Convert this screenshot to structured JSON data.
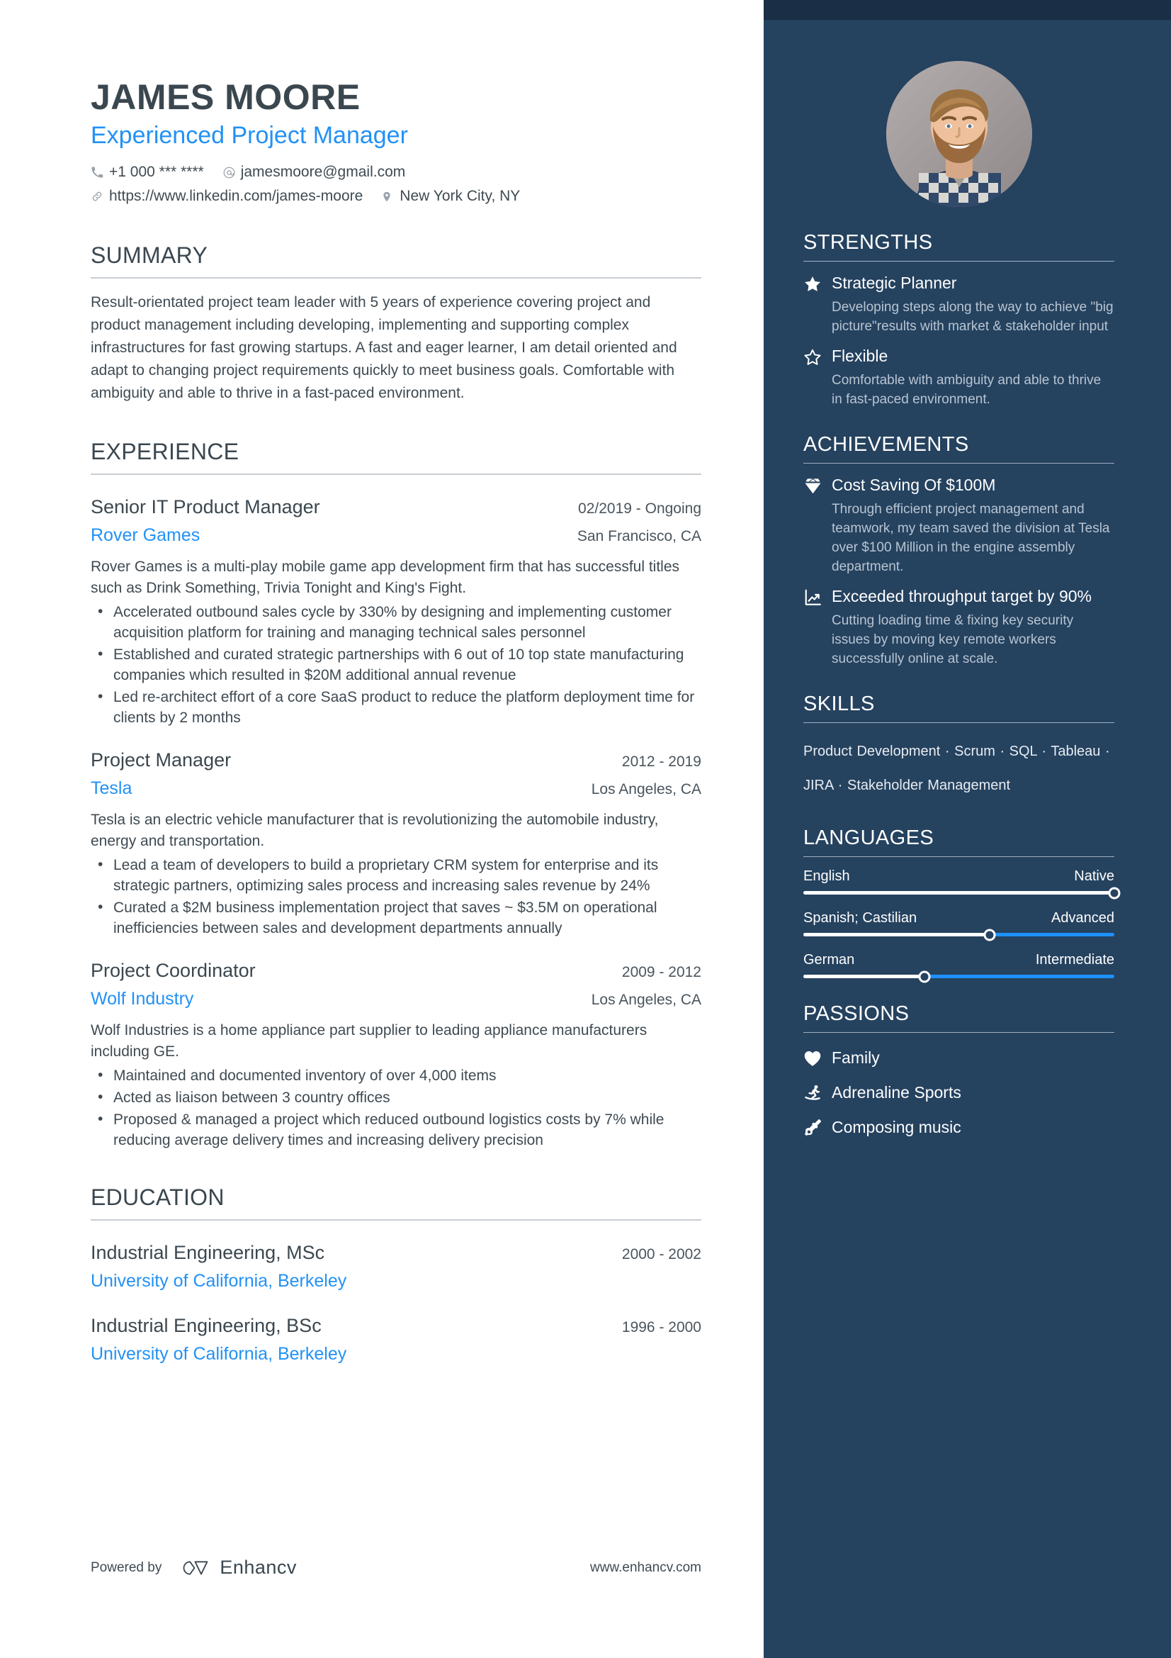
{
  "header": {
    "name": "JAMES MOORE",
    "headline": "Experienced Project Manager",
    "contacts": [
      {
        "icon": "phone-icon",
        "text": "+1 000 *** ****"
      },
      {
        "icon": "email-icon",
        "text": "jamesmoore@gmail.com"
      },
      {
        "icon": "link-icon",
        "text": "https://www.linkedin.com/james-moore"
      },
      {
        "icon": "location-icon",
        "text": "New York City, NY"
      }
    ]
  },
  "summary": {
    "title": "SUMMARY",
    "text": "Result-orientated project team leader with 5 years of experience covering project and product management including developing, implementing and supporting complex infrastructures for fast growing startups. A fast and eager learner, I am detail oriented and adapt to changing project requirements quickly to meet business goals. Comfortable with ambiguity and able to thrive in a fast-paced environment."
  },
  "experience": {
    "title": "EXPERIENCE",
    "jobs": [
      {
        "title": "Senior IT Product Manager",
        "date": "02/2019 - Ongoing",
        "org": "Rover Games",
        "location": "San Francisco, CA",
        "desc": "Rover Games is a multi-play mobile game app development firm that has successful titles such as Drink Something, Trivia Tonight and King's Fight.",
        "bullets": [
          "Accelerated outbound sales cycle by 330% by designing and implementing customer acquisition platform for training and managing technical sales personnel",
          "Established and curated strategic partnerships with 6 out of 10 top state manufacturing companies which resulted in $20M additional annual revenue",
          "Led re-architect effort of a core SaaS product to reduce the platform deployment time for clients by 2 months"
        ]
      },
      {
        "title": "Project Manager",
        "date": "2012 - 2019",
        "org": "Tesla",
        "location": "Los Angeles, CA",
        "desc": "Tesla is an electric vehicle manufacturer that is revolutionizing the automobile industry, energy and transportation.",
        "bullets": [
          "Lead a team of developers to build a proprietary CRM system for enterprise and its strategic partners, optimizing sales process and increasing sales revenue by 24%",
          "Curated a $2M business implementation project that saves ~ $3.5M on operational inefficiencies between sales and development departments annually"
        ]
      },
      {
        "title": "Project Coordinator",
        "date": "2009 - 2012",
        "org": "Wolf Industry",
        "location": "Los Angeles, CA",
        "desc": "Wolf Industries is a home appliance part supplier to leading appliance manufacturers including GE.",
        "bullets": [
          "Maintained and documented inventory of over 4,000 items",
          "Acted as liaison between 3 country offices",
          "Proposed & managed a project which reduced outbound logistics costs by 7% while reducing average delivery times and increasing delivery precision"
        ]
      }
    ]
  },
  "education": {
    "title": "EDUCATION",
    "items": [
      {
        "degree": "Industrial Engineering, MSc",
        "date": "2000 - 2002",
        "school": "University of California, Berkeley"
      },
      {
        "degree": "Industrial Engineering, BSc",
        "date": "1996 - 2000",
        "school": "University of California, Berkeley"
      }
    ]
  },
  "strengths": {
    "title": "STRENGTHS",
    "items": [
      {
        "icon": "star-filled-icon",
        "name": "Strategic Planner",
        "desc": "Developing steps along the way to achieve \"big picture\"results with market & stakeholder input"
      },
      {
        "icon": "star-outline-icon",
        "name": "Flexible",
        "desc": "Comfortable with ambiguity and able to thrive in fast-paced environment."
      }
    ]
  },
  "achievements": {
    "title": "ACHIEVEMENTS",
    "items": [
      {
        "icon": "diamond-icon",
        "name": "Cost Saving Of $100M",
        "desc": "Through efficient project management and teamwork, my team saved the division at Tesla over $100 Million in the engine assembly department."
      },
      {
        "icon": "chart-up-icon",
        "name": "Exceeded throughput target by 90%",
        "desc": "Cutting loading time & fixing key security issues by moving key remote workers successfully online at scale."
      }
    ]
  },
  "skills": {
    "title": "SKILLS",
    "text": "Product Development · Scrum · SQL · Tableau · JIRA · Stakeholder Management"
  },
  "languages": {
    "title": "LANGUAGES",
    "items": [
      {
        "name": "English",
        "level": "Native",
        "percent": 100
      },
      {
        "name": "Spanish; Castilian",
        "level": "Advanced",
        "percent": 60
      },
      {
        "name": "German",
        "level": "Intermediate",
        "percent": 39
      }
    ]
  },
  "passions": {
    "title": "PASSIONS",
    "items": [
      {
        "icon": "heart-icon",
        "label": "Family"
      },
      {
        "icon": "snowboarder-icon",
        "label": "Adrenaline Sports"
      },
      {
        "icon": "guitar-icon",
        "label": "Composing music"
      }
    ]
  },
  "footer": {
    "powered_by": "Powered by",
    "brand": "Enhancv",
    "url": "www.enhancv.com"
  },
  "colors": {
    "accent_blue": "#2291f5",
    "sidebar_bg": "#25425f",
    "sidebar_top": "#1a2e45",
    "text_dark": "#3b474f"
  }
}
